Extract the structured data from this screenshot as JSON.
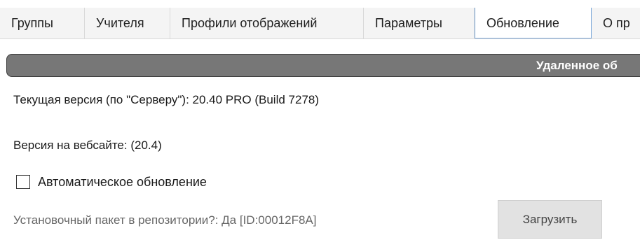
{
  "tabs": [
    {
      "label": "Группы"
    },
    {
      "label": "Учителя"
    },
    {
      "label": "Профили отображений"
    },
    {
      "label": "Параметры"
    },
    {
      "label": "Обновление",
      "active": true
    },
    {
      "label": "О пр"
    }
  ],
  "group": {
    "title": "Удаленное об"
  },
  "update": {
    "current_version_line": "Текущая версия (по \"Серверу\"): 20.40 PRO (Build 7278)",
    "website_version_line": "Версия на вебсайте:  (20.4)",
    "auto_update_label": "Автоматическое обновление",
    "auto_update_checked": false,
    "repo_line": "Установочный пакет в репозитории?:  Да [ID:00012F8A]",
    "download_button": "Загрузить"
  },
  "colors": {
    "header_bg": "#777777",
    "tab_active_border": "#7aa7d8",
    "button_bg": "#e2e2e2"
  }
}
